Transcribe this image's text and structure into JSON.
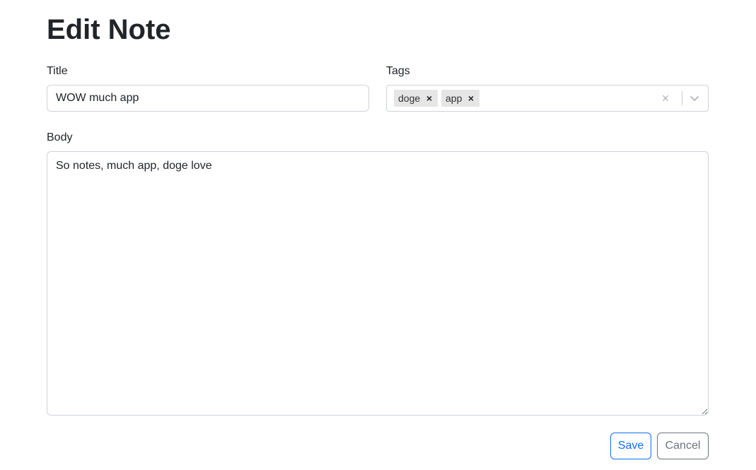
{
  "page": {
    "title": "Edit Note"
  },
  "form": {
    "title_label": "Title",
    "title_value": "WOW much app",
    "tags_label": "Tags",
    "tags": [
      {
        "label": "doge"
      },
      {
        "label": "app"
      }
    ],
    "body_label": "Body",
    "body_value": "So notes, much app, doge love"
  },
  "icons": {
    "tag_remove": "close-icon",
    "clear_all": "close-icon",
    "dropdown": "chevron-down-icon"
  },
  "actions": {
    "save_label": "Save",
    "cancel_label": "Cancel"
  },
  "colors": {
    "primary": "#0d6efd",
    "secondary": "#6c757d",
    "border": "#ced4da",
    "chip_bg": "#e6e6e6"
  }
}
